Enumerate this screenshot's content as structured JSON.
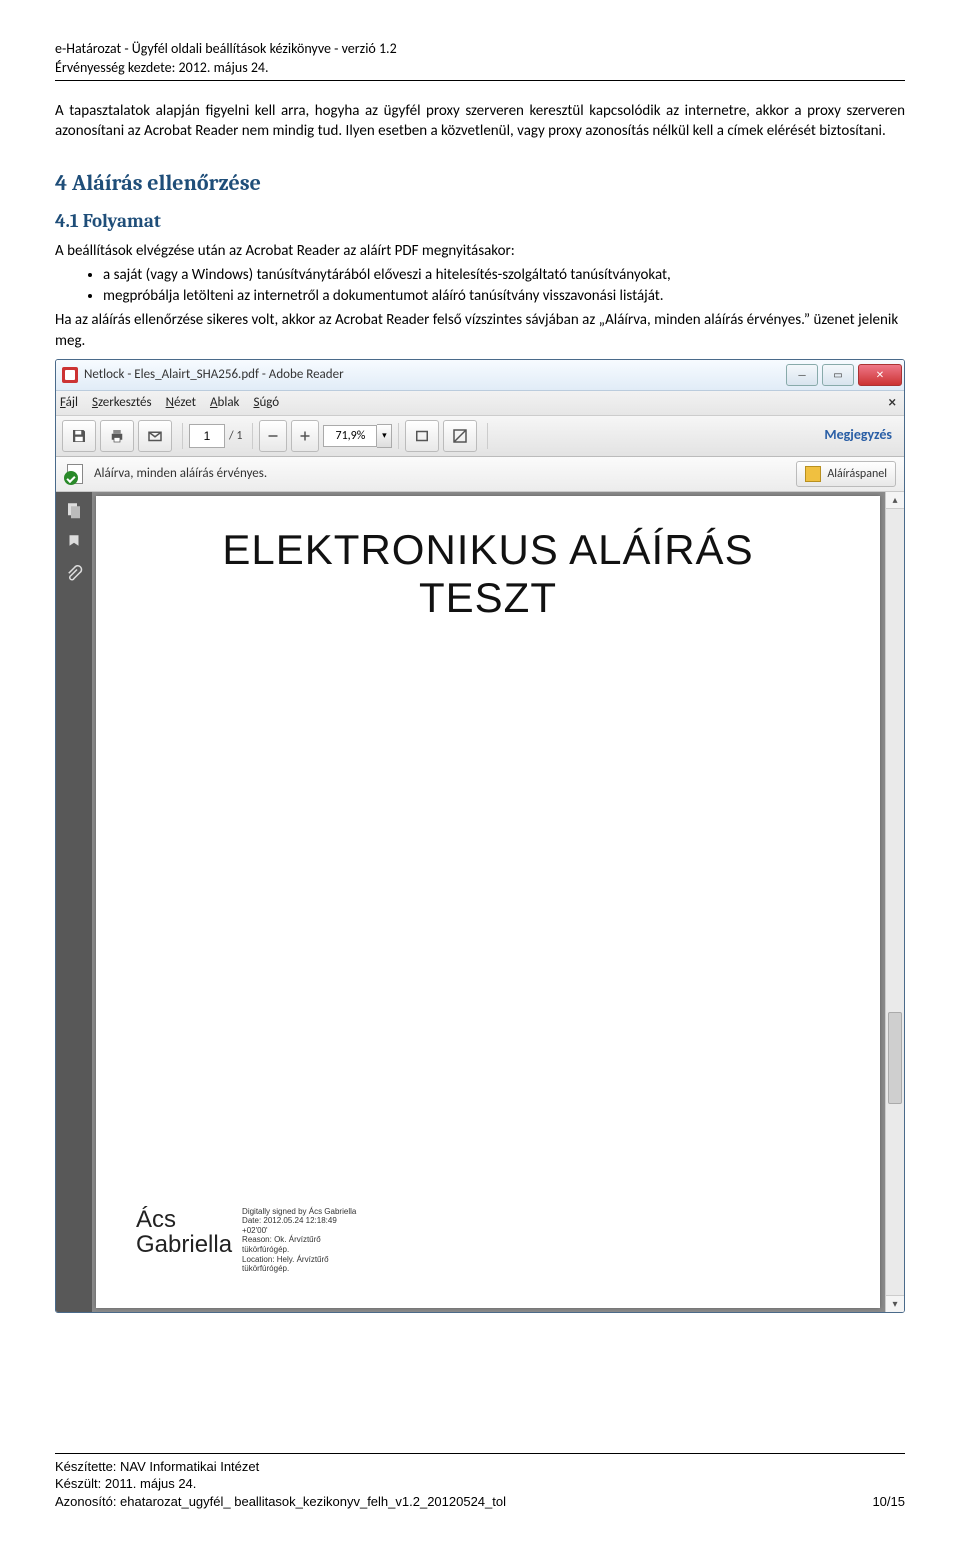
{
  "header": {
    "line1": "e-Határozat - Ügyfél oldali beállítások kézikönyve - verzió 1.2",
    "line2": "Érvényesség kezdete: 2012. május 24."
  },
  "body": {
    "para1": "A tapasztalatok alapján figyelni kell arra, hogyha az ügyfél proxy szerveren keresztül kapcsolódik az internetre, akkor a proxy szerveren azonosítani az Acrobat Reader nem mindig tud. Ilyen esetben a közvetlenül, vagy proxy azonosítás nélkül kell a címek elérését biztosítani.",
    "h1": "4   Aláírás ellenőrzése",
    "h2": "4.1   Folyamat",
    "intro": "A beállítások elvégzése után az Acrobat Reader az aláírt PDF megnyitásakor:",
    "bullets": [
      "a saját (vagy a Windows) tanúsítványtárából előveszi a hitelesítés-szolgáltató tanúsítványokat,",
      "megpróbálja letölteni az internetről a dokumentumot aláíró tanúsítvány visszavonási listáját."
    ],
    "conclude": "Ha az aláírás ellenőrzése sikeres volt, akkor az Acrobat Reader felső vízszintes sávjában az „Aláírva, minden aláírás érvényes.” üzenet jelenik meg."
  },
  "window": {
    "title": "Netlock - Eles_Alairt_SHA256.pdf - Adobe Reader",
    "menu": {
      "file": "Fájl",
      "edit": "Szerkesztés",
      "view": "Nézet",
      "window": "Ablak",
      "help": "Súgó"
    },
    "toolbar": {
      "page_value": "1",
      "page_of": "/ 1",
      "zoom": "71,9%",
      "comment": "Megjegyzés"
    },
    "sigbar": {
      "msg": "Aláírva, minden aláírás érvényes.",
      "panel": "Aláíráspanel"
    }
  },
  "pdf": {
    "title_line1": "ELEKTRONIKUS ALÁÍRÁS",
    "title_line2": "TESZT",
    "sig_name_1": "Ács",
    "sig_name_2": "Gabriella",
    "sig_details": "Digitally signed by Ács Gabriella\nDate: 2012.05.24 12:18:49\n+02'00'\nReason: Ok. Árvíztűrő\ntükörfúrógép.\nLocation: Hely. Árvíztűrő\ntükörfúrógép."
  },
  "footer": {
    "l1": "Készítette: NAV Informatikai Intézet",
    "l2": "Készült: 2011. május 24.",
    "l3": "Azonosító: ehatarozat_ugyfél_ beallitasok_kezikonyv_felh_v1.2_20120524_tol",
    "page": "10/15"
  }
}
